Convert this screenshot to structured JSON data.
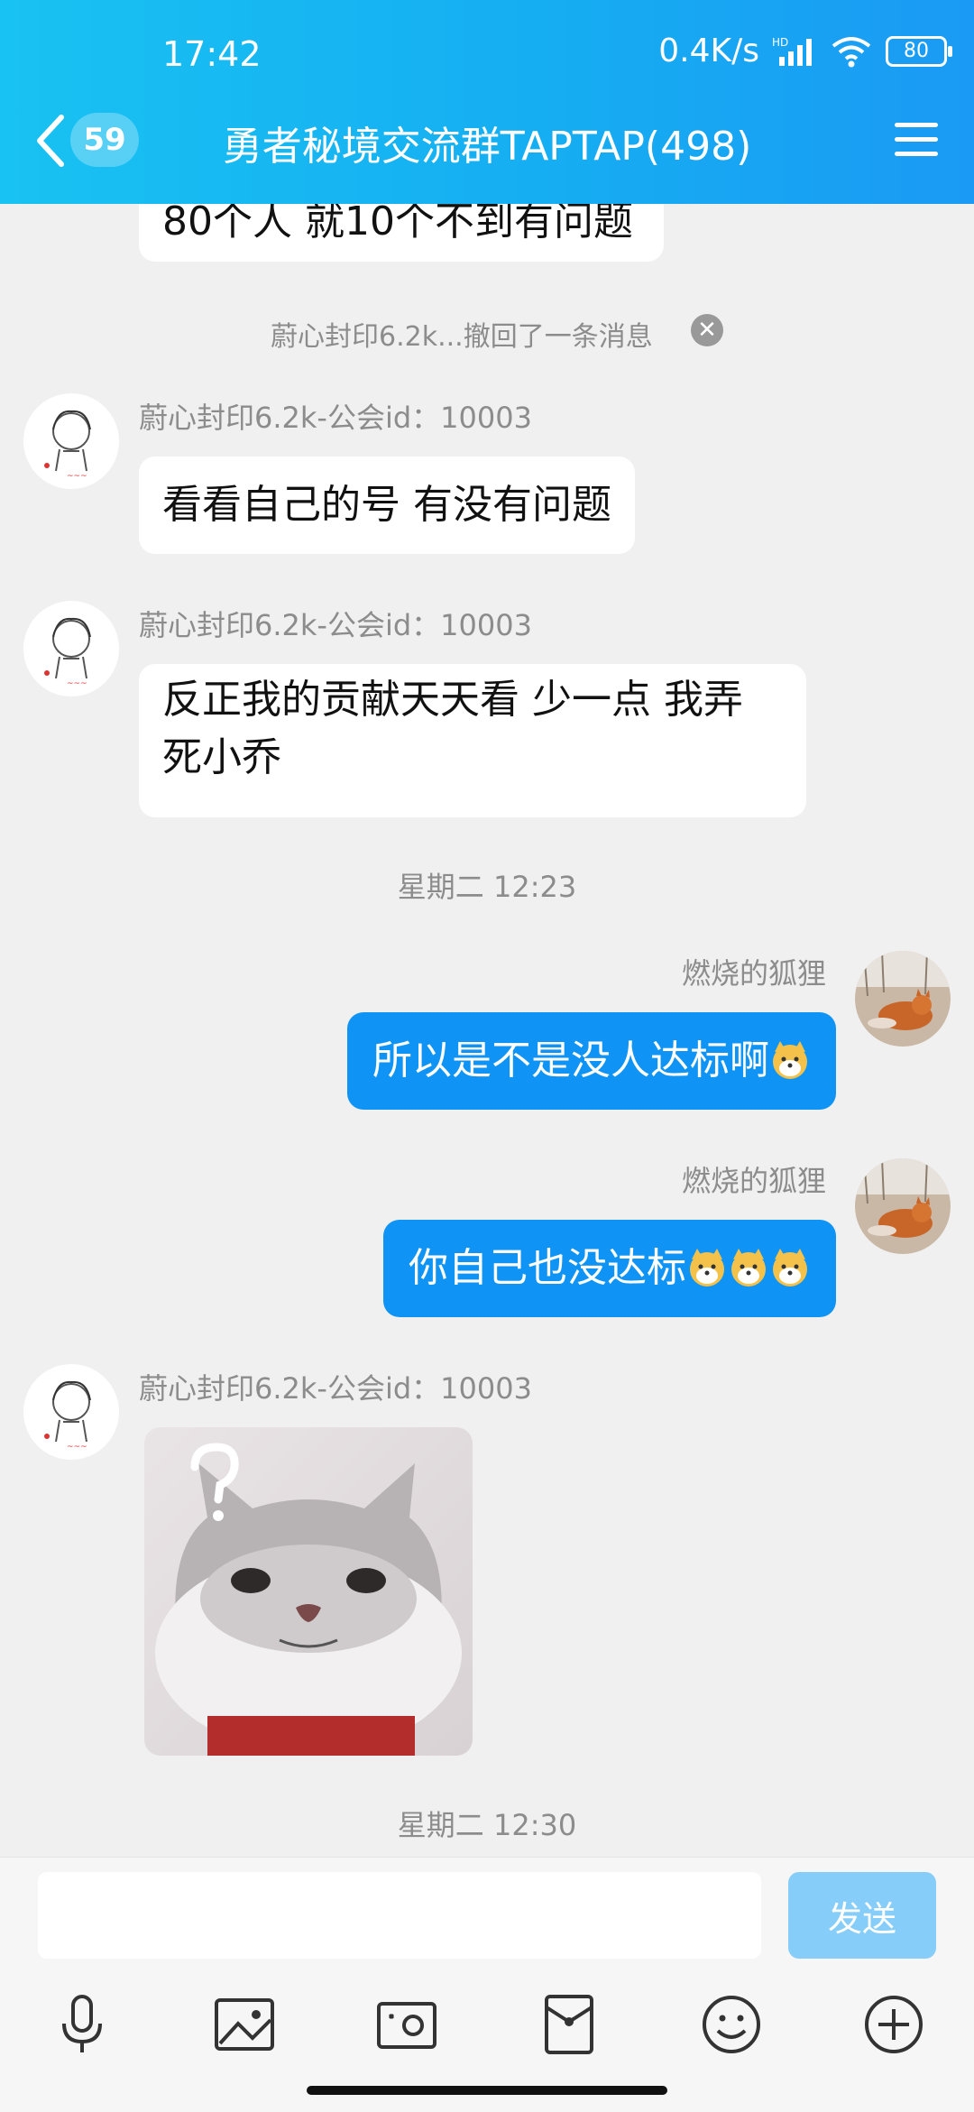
{
  "status": {
    "time": "17:42",
    "network_speed": "0.4K/s",
    "hd": "HD",
    "battery": "80"
  },
  "header": {
    "unread_count": "59",
    "title": "勇者秘境交流群TAPTAP(498)"
  },
  "messages": {
    "partial_text": "80个人 就10个不到有问题",
    "system_notice": "蔚心封印6.2k...撤回了一条消息",
    "msg1_sender": "蔚心封印6.2k-公会id：10003",
    "msg1_text": "看看自己的号 有没有问题",
    "msg2_sender": "蔚心封印6.2k-公会id：10003",
    "msg2_line1": "反正我的贡献天天看 少一点 我弄",
    "msg2_line2": "死小乔",
    "time1": "星期二 12:23",
    "msg3_sender": "燃烧的狐狸",
    "msg3_text": "所以是不是没人达标啊",
    "msg4_sender": "燃烧的狐狸",
    "msg4_text": "你自己也没达标",
    "msg5_sender": "蔚心封印6.2k-公会id：10003",
    "time2": "星期二 12:30"
  },
  "input": {
    "placeholder": "",
    "send_label": "发送"
  },
  "colors": {
    "header_start": "#18c2f2",
    "header_end": "#1a9af4",
    "my_bubble": "#0f94f5",
    "send_disabled": "#87cdf9"
  }
}
